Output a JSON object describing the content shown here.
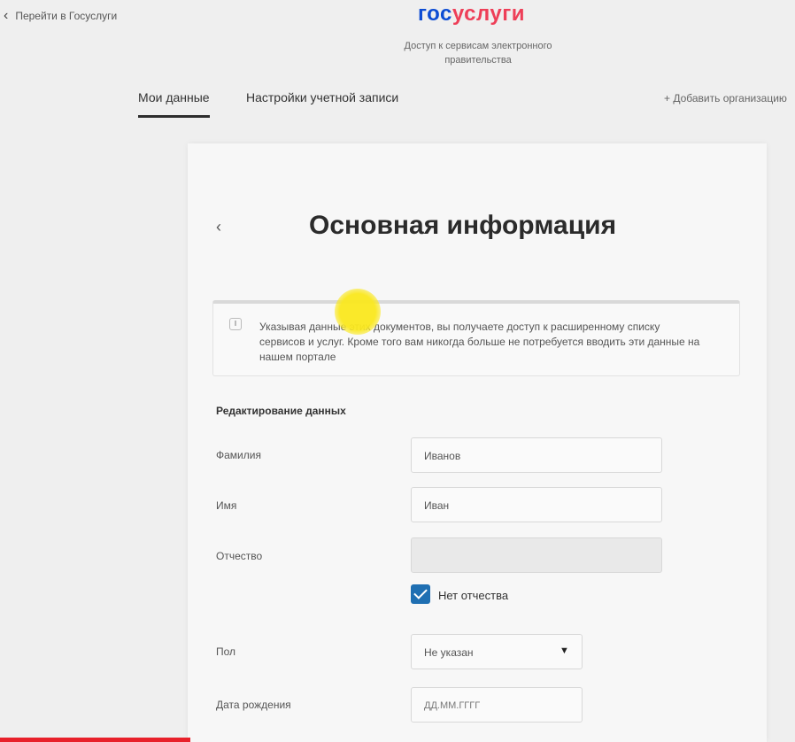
{
  "header": {
    "back_link": "Перейти в Госуслуги",
    "logo_part1": "гос",
    "logo_part2": "услуги",
    "tagline": "Доступ к сервисам электронного правительства"
  },
  "nav": {
    "tabs": [
      {
        "label": "Мои данные",
        "active": true
      },
      {
        "label": "Настройки учетной записи",
        "active": false
      }
    ],
    "add_org": "+ Добавить организацию"
  },
  "page": {
    "title": "Основная информация",
    "notice": "Указывая данные этих документов, вы получаете доступ к расширенному списку сервисов и услуг. Кроме того вам никогда больше не потребуется вводить эти данные на нашем портале"
  },
  "form": {
    "section_title": "Редактирование данных",
    "surname_label": "Фамилия",
    "surname_value": "Иванов",
    "name_label": "Имя",
    "name_value": "Иван",
    "patronymic_label": "Отчество",
    "patronymic_value": "",
    "no_patronymic_label": "Нет отчества",
    "no_patronymic_checked": true,
    "gender_label": "Пол",
    "gender_value": "Не указан",
    "birthdate_label": "Дата рождения",
    "birthdate_placeholder": "ДД.ММ.ГГГГ"
  },
  "colors": {
    "brand_blue": "#0d4cd3",
    "brand_red": "#ee3f58",
    "checkbox": "#1f6fb2",
    "highlight": "#fae81e",
    "video_progress": "#e8202a"
  }
}
